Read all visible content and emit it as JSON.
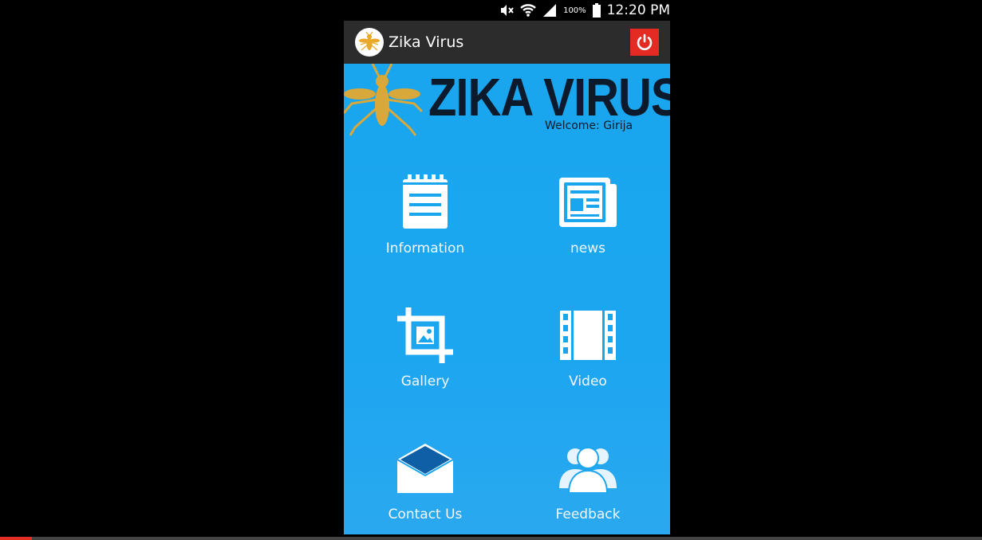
{
  "status_bar": {
    "battery": "100%",
    "time": "12:20 PM",
    "icons": [
      "mute-icon",
      "wifi-icon",
      "signal-icon",
      "battery-icon"
    ]
  },
  "action_bar": {
    "title": "Zika Virus",
    "power_icon": "power-icon"
  },
  "banner": {
    "title": "ZIKA VIRUS",
    "welcome": "Welcome: Girija"
  },
  "menu": [
    {
      "label": "Information",
      "icon": "notepad-icon"
    },
    {
      "label": "news",
      "icon": "newspaper-icon"
    },
    {
      "label": "Gallery",
      "icon": "crop-image-icon"
    },
    {
      "label": "Video",
      "icon": "film-strip-icon"
    },
    {
      "label": "Contact Us",
      "icon": "envelope-icon"
    },
    {
      "label": "Feedback",
      "icon": "people-icon"
    }
  ],
  "colors": {
    "background": "#1aa5ef",
    "action_bar": "#2c2c2c",
    "power_button": "#e32b24",
    "banner_text": "#0d1a2b",
    "mosquito": "#e8a82a"
  }
}
